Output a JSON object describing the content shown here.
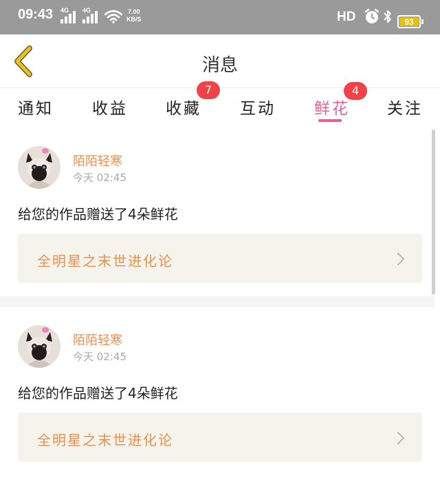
{
  "status_bar": {
    "time": "09:43",
    "net1": "4G",
    "net2": "4G",
    "speed_value": "7.00",
    "speed_unit": "KB/S",
    "hd": "HD",
    "battery": "93",
    "battery_color": "#e6c100"
  },
  "header": {
    "title": "消息",
    "back_icon": "chevron-left-icon",
    "back_color": "#e8bf2e"
  },
  "tabs": [
    {
      "label": "通知",
      "badge": ""
    },
    {
      "label": "收益",
      "badge": ""
    },
    {
      "label": "收藏",
      "badge": "7"
    },
    {
      "label": "互动",
      "badge": ""
    },
    {
      "label": "鲜花",
      "badge": "4",
      "active": true
    },
    {
      "label": "关注",
      "badge": ""
    }
  ],
  "colors": {
    "accent": "#ea5f95",
    "badge": "#f04249",
    "username": "#ef8f4e",
    "link_bg": "#f4f4ed"
  },
  "notifications": [
    {
      "user": "陌陌轻寒",
      "time": "今天 02:45",
      "message": "给您的作品赠送了4朵鲜花",
      "work": "全明星之末世进化论"
    },
    {
      "user": "陌陌轻寒",
      "time": "今天 02:45",
      "message": "给您的作品赠送了4朵鲜花",
      "work": "全明星之末世进化论"
    }
  ]
}
